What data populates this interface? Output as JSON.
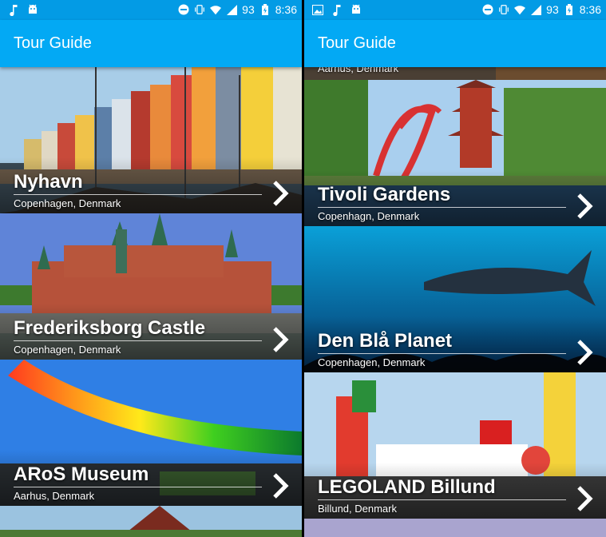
{
  "status_left": {
    "icons": [
      "music-note-icon",
      "android-icon"
    ],
    "battery": "93",
    "time": "8:36"
  },
  "status_right": {
    "icons": [
      "image-icon",
      "music-note-icon",
      "android-icon"
    ],
    "battery": "93",
    "time": "8:36"
  },
  "app": {
    "title": "Tour Guide",
    "accent": "#03a9f4",
    "statusbar_color": "#039be5"
  },
  "left_list": [
    {
      "name": "Nyhavn",
      "location": "Copenhagen, Denmark"
    },
    {
      "name": "Frederiksborg Castle",
      "location": "Copenhagen, Denmark"
    },
    {
      "name": "ARoS Museum",
      "location": "Aarhus, Denmark"
    }
  ],
  "right_list": [
    {
      "name": "",
      "location": "Aarhus, Denmark"
    },
    {
      "name": "Tivoli Gardens",
      "location": "Copenhagn, Denmark"
    },
    {
      "name": "Den Blå Planet",
      "location": "Copenhagen, Denmark"
    },
    {
      "name": "LEGOLAND Billund",
      "location": "Billund, Denmark"
    }
  ]
}
